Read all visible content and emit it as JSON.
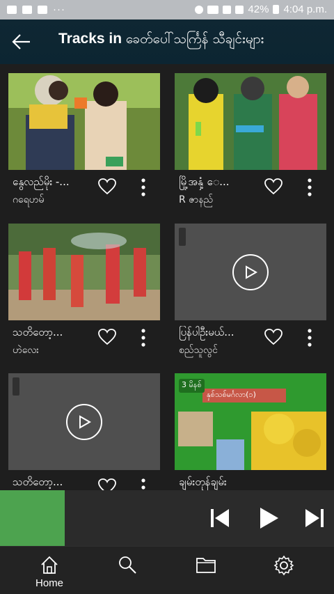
{
  "status_bar": {
    "battery": "42%",
    "time": "4:04 p.m."
  },
  "header": {
    "title_prefix": "Tracks in",
    "title_category": "ခေတ်ပေါ်သင်္ကြန် သီချင်းများ",
    "back_icon": "arrow-left-icon"
  },
  "tracks": [
    {
      "title": "နွေလည်မိုး -...",
      "artist": "ဂရေဟမ်"
    },
    {
      "title": "မြို့အနှံ့ ေ...",
      "artist": "R ဇာနည်"
    },
    {
      "title": "သတိတော့...",
      "artist": "ဟဲလေး"
    },
    {
      "title": "ပြန်ပါဦးမယ်...",
      "artist": "စည်သူလွင်"
    },
    {
      "title": "သတိတော့...",
      "artist": ""
    },
    {
      "title": "ချမ်းတုန်ချမ်း",
      "artist": ""
    }
  ],
  "thumb_badge": "3 မိနစ်",
  "thumb_caption": "နှစ်သစ်မင်္ဂလာ(၁)",
  "player": {
    "controls": [
      "skip-previous-icon",
      "play-icon",
      "skip-next-icon"
    ],
    "art_color": "#4da34f"
  },
  "bottom_nav": {
    "home_label": "Home",
    "items": [
      "home-icon",
      "search-icon",
      "folder-icon",
      "settings-icon"
    ]
  }
}
